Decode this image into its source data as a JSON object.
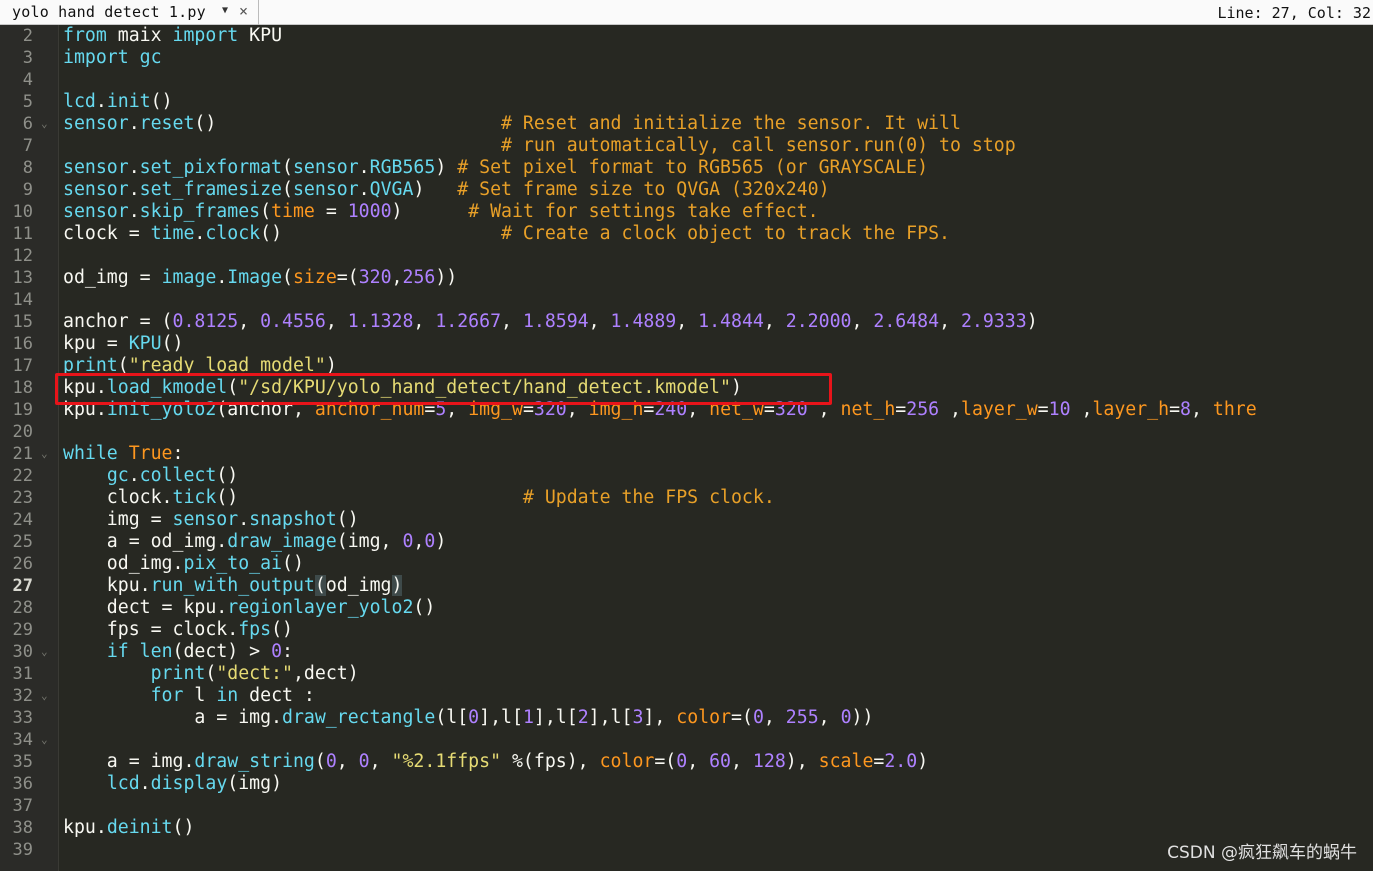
{
  "tab": {
    "filename": "yolo hand detect 1.py",
    "dropdown": "▼",
    "close": "×"
  },
  "status_bar": {
    "position": "Line: 27, Col: 32"
  },
  "line_numbers": [
    "2",
    "3",
    "4",
    "5",
    "6",
    "7",
    "8",
    "9",
    "10",
    "11",
    "12",
    "13",
    "14",
    "15",
    "16",
    "17",
    "18",
    "19",
    "20",
    "21",
    "22",
    "23",
    "24",
    "25",
    "26",
    "27",
    "28",
    "29",
    "30",
    "31",
    "32",
    "33",
    "34",
    "35",
    "36",
    "37",
    "38",
    "39"
  ],
  "current_line": "27",
  "fold_lines": [
    "6",
    "21",
    "30",
    "32",
    "34"
  ],
  "code_lines": [
    [
      [
        "k",
        "from"
      ],
      [
        "b",
        " maix "
      ],
      [
        "k",
        "import"
      ],
      [
        "b",
        " KPU"
      ]
    ],
    [
      [
        "k",
        "import"
      ],
      [
        "b",
        " "
      ],
      [
        "f",
        "gc"
      ]
    ],
    [],
    [
      [
        "f",
        "lcd"
      ],
      [
        "b",
        "."
      ],
      [
        "f",
        "init"
      ],
      [
        "b",
        "()"
      ]
    ],
    [
      [
        "f",
        "sensor"
      ],
      [
        "b",
        "."
      ],
      [
        "f",
        "reset"
      ],
      [
        "b",
        "()                          "
      ],
      [
        "c",
        "# Reset and initialize the sensor. It will"
      ]
    ],
    [
      [
        "b",
        "                                        "
      ],
      [
        "c",
        "# run automatically, call sensor.run(0) to stop"
      ]
    ],
    [
      [
        "f",
        "sensor"
      ],
      [
        "b",
        "."
      ],
      [
        "f",
        "set_pixformat"
      ],
      [
        "b",
        "("
      ],
      [
        "f",
        "sensor"
      ],
      [
        "b",
        "."
      ],
      [
        "f",
        "RGB565"
      ],
      [
        "b",
        ") "
      ],
      [
        "c",
        "# Set pixel format to RGB565 (or GRAYSCALE)"
      ]
    ],
    [
      [
        "f",
        "sensor"
      ],
      [
        "b",
        "."
      ],
      [
        "f",
        "set_framesize"
      ],
      [
        "b",
        "("
      ],
      [
        "f",
        "sensor"
      ],
      [
        "b",
        "."
      ],
      [
        "f",
        "QVGA"
      ],
      [
        "b",
        ")   "
      ],
      [
        "c",
        "# Set frame size to QVGA (320x240)"
      ]
    ],
    [
      [
        "f",
        "sensor"
      ],
      [
        "b",
        "."
      ],
      [
        "f",
        "skip_frames"
      ],
      [
        "b",
        "("
      ],
      [
        "p",
        "time"
      ],
      [
        "b",
        " = "
      ],
      [
        "n",
        "1000"
      ],
      [
        "b",
        ")      "
      ],
      [
        "c",
        "# Wait for settings take effect."
      ]
    ],
    [
      [
        "b",
        "clock = "
      ],
      [
        "f",
        "time"
      ],
      [
        "b",
        "."
      ],
      [
        "f",
        "clock"
      ],
      [
        "b",
        "()                    "
      ],
      [
        "c",
        "# Create a clock object to track the FPS."
      ]
    ],
    [],
    [
      [
        "b",
        "od_img = "
      ],
      [
        "f",
        "image"
      ],
      [
        "b",
        "."
      ],
      [
        "f",
        "Image"
      ],
      [
        "b",
        "("
      ],
      [
        "p",
        "size"
      ],
      [
        "b",
        "=("
      ],
      [
        "n",
        "320"
      ],
      [
        "b",
        ","
      ],
      [
        "n",
        "256"
      ],
      [
        "b",
        "))"
      ]
    ],
    [],
    [
      [
        "b",
        "anchor = ("
      ],
      [
        "n",
        "0.8125"
      ],
      [
        "b",
        ", "
      ],
      [
        "n",
        "0.4556"
      ],
      [
        "b",
        ", "
      ],
      [
        "n",
        "1.1328"
      ],
      [
        "b",
        ", "
      ],
      [
        "n",
        "1.2667"
      ],
      [
        "b",
        ", "
      ],
      [
        "n",
        "1.8594"
      ],
      [
        "b",
        ", "
      ],
      [
        "n",
        "1.4889"
      ],
      [
        "b",
        ", "
      ],
      [
        "n",
        "1.4844"
      ],
      [
        "b",
        ", "
      ],
      [
        "n",
        "2.2000"
      ],
      [
        "b",
        ", "
      ],
      [
        "n",
        "2.6484"
      ],
      [
        "b",
        ", "
      ],
      [
        "n",
        "2.9333"
      ],
      [
        "b",
        ")"
      ]
    ],
    [
      [
        "b",
        "kpu = "
      ],
      [
        "f",
        "KPU"
      ],
      [
        "b",
        "()"
      ]
    ],
    [
      [
        "f",
        "print"
      ],
      [
        "b",
        "("
      ],
      [
        "s",
        "\"ready load model\""
      ],
      [
        "b",
        ")"
      ]
    ],
    [
      [
        "b",
        "kpu."
      ],
      [
        "f",
        "load_kmodel"
      ],
      [
        "b",
        "("
      ],
      [
        "s",
        "\"/sd/KPU/yolo_hand_detect/hand_detect.kmodel\""
      ],
      [
        "b",
        ")"
      ]
    ],
    [
      [
        "b",
        "kpu."
      ],
      [
        "f",
        "init_yolo2"
      ],
      [
        "b",
        "(anchor, "
      ],
      [
        "p",
        "anchor_num"
      ],
      [
        "b",
        "="
      ],
      [
        "n",
        "5"
      ],
      [
        "b",
        ", "
      ],
      [
        "p",
        "img_w"
      ],
      [
        "b",
        "="
      ],
      [
        "n",
        "320"
      ],
      [
        "b",
        ", "
      ],
      [
        "p",
        "img_h"
      ],
      [
        "b",
        "="
      ],
      [
        "n",
        "240"
      ],
      [
        "b",
        ", "
      ],
      [
        "p",
        "net_w"
      ],
      [
        "b",
        "="
      ],
      [
        "n",
        "320"
      ],
      [
        "b",
        " , "
      ],
      [
        "p",
        "net_h"
      ],
      [
        "b",
        "="
      ],
      [
        "n",
        "256"
      ],
      [
        "b",
        " ,"
      ],
      [
        "p",
        "layer_w"
      ],
      [
        "b",
        "="
      ],
      [
        "n",
        "10"
      ],
      [
        "b",
        " ,"
      ],
      [
        "p",
        "layer_h"
      ],
      [
        "b",
        "="
      ],
      [
        "n",
        "8"
      ],
      [
        "b",
        ", "
      ],
      [
        "p",
        "thre"
      ]
    ],
    [],
    [
      [
        "k",
        "while"
      ],
      [
        "b",
        " "
      ],
      [
        "p",
        "True"
      ],
      [
        "b",
        ":"
      ]
    ],
    [
      [
        "b",
        "    "
      ],
      [
        "f",
        "gc"
      ],
      [
        "b",
        "."
      ],
      [
        "f",
        "collect"
      ],
      [
        "b",
        "()"
      ]
    ],
    [
      [
        "b",
        "    clock."
      ],
      [
        "f",
        "tick"
      ],
      [
        "b",
        "()                          "
      ],
      [
        "c",
        "# Update the FPS clock."
      ]
    ],
    [
      [
        "b",
        "    img = "
      ],
      [
        "f",
        "sensor"
      ],
      [
        "b",
        "."
      ],
      [
        "f",
        "snapshot"
      ],
      [
        "b",
        "()"
      ]
    ],
    [
      [
        "b",
        "    a = od_img."
      ],
      [
        "f",
        "draw_image"
      ],
      [
        "b",
        "(img, "
      ],
      [
        "n",
        "0"
      ],
      [
        "b",
        ","
      ],
      [
        "n",
        "0"
      ],
      [
        "b",
        ")"
      ]
    ],
    [
      [
        "b",
        "    od_img."
      ],
      [
        "f",
        "pix_to_ai"
      ],
      [
        "b",
        "()"
      ]
    ],
    [
      [
        "b",
        "    kpu."
      ],
      [
        "f",
        "run_with_output"
      ],
      [
        "mt",
        "("
      ],
      [
        "b",
        "od_img"
      ],
      [
        "mt",
        ")"
      ]
    ],
    [
      [
        "b",
        "    dect = kpu."
      ],
      [
        "f",
        "regionlayer_yolo2"
      ],
      [
        "b",
        "()"
      ]
    ],
    [
      [
        "b",
        "    fps = clock."
      ],
      [
        "f",
        "fps"
      ],
      [
        "b",
        "()"
      ]
    ],
    [
      [
        "b",
        "    "
      ],
      [
        "k",
        "if"
      ],
      [
        "b",
        " "
      ],
      [
        "f",
        "len"
      ],
      [
        "b",
        "(dect) > "
      ],
      [
        "n",
        "0"
      ],
      [
        "b",
        ":"
      ]
    ],
    [
      [
        "b",
        "        "
      ],
      [
        "f",
        "print"
      ],
      [
        "b",
        "("
      ],
      [
        "s",
        "\"dect:\""
      ],
      [
        "b",
        ",dect)"
      ]
    ],
    [
      [
        "b",
        "        "
      ],
      [
        "k",
        "for"
      ],
      [
        "b",
        " l "
      ],
      [
        "k",
        "in"
      ],
      [
        "b",
        " dect :"
      ]
    ],
    [
      [
        "b",
        "            a = img."
      ],
      [
        "f",
        "draw_rectangle"
      ],
      [
        "b",
        "(l["
      ],
      [
        "n",
        "0"
      ],
      [
        "b",
        "],l["
      ],
      [
        "n",
        "1"
      ],
      [
        "b",
        "],l["
      ],
      [
        "n",
        "2"
      ],
      [
        "b",
        "],l["
      ],
      [
        "n",
        "3"
      ],
      [
        "b",
        "], "
      ],
      [
        "p",
        "color"
      ],
      [
        "b",
        "=("
      ],
      [
        "n",
        "0"
      ],
      [
        "b",
        ", "
      ],
      [
        "n",
        "255"
      ],
      [
        "b",
        ", "
      ],
      [
        "n",
        "0"
      ],
      [
        "b",
        "))"
      ]
    ],
    [],
    [
      [
        "b",
        "    a = img."
      ],
      [
        "f",
        "draw_string"
      ],
      [
        "b",
        "("
      ],
      [
        "n",
        "0"
      ],
      [
        "b",
        ", "
      ],
      [
        "n",
        "0"
      ],
      [
        "b",
        ", "
      ],
      [
        "s",
        "\"%2.1ffps\""
      ],
      [
        "b",
        " %(fps), "
      ],
      [
        "p",
        "color"
      ],
      [
        "b",
        "=("
      ],
      [
        "n",
        "0"
      ],
      [
        "b",
        ", "
      ],
      [
        "n",
        "60"
      ],
      [
        "b",
        ", "
      ],
      [
        "n",
        "128"
      ],
      [
        "b",
        "), "
      ],
      [
        "p",
        "scale"
      ],
      [
        "b",
        "="
      ],
      [
        "n",
        "2.0"
      ],
      [
        "b",
        ")"
      ]
    ],
    [
      [
        "b",
        "    "
      ],
      [
        "f",
        "lcd"
      ],
      [
        "b",
        "."
      ],
      [
        "f",
        "display"
      ],
      [
        "b",
        "(img)"
      ]
    ],
    [],
    [
      [
        "b",
        "kpu."
      ],
      [
        "f",
        "deinit"
      ],
      [
        "b",
        "()"
      ]
    ],
    []
  ],
  "watermark": "CSDN @疯狂飙车的蜗牛",
  "colors": {
    "background": "#272822",
    "keyword": "#66d9ef",
    "string": "#e6db74",
    "number": "#ae81ff",
    "comment": "#e8a028",
    "param": "#fd971f",
    "highlight_box": "#e8141a"
  }
}
